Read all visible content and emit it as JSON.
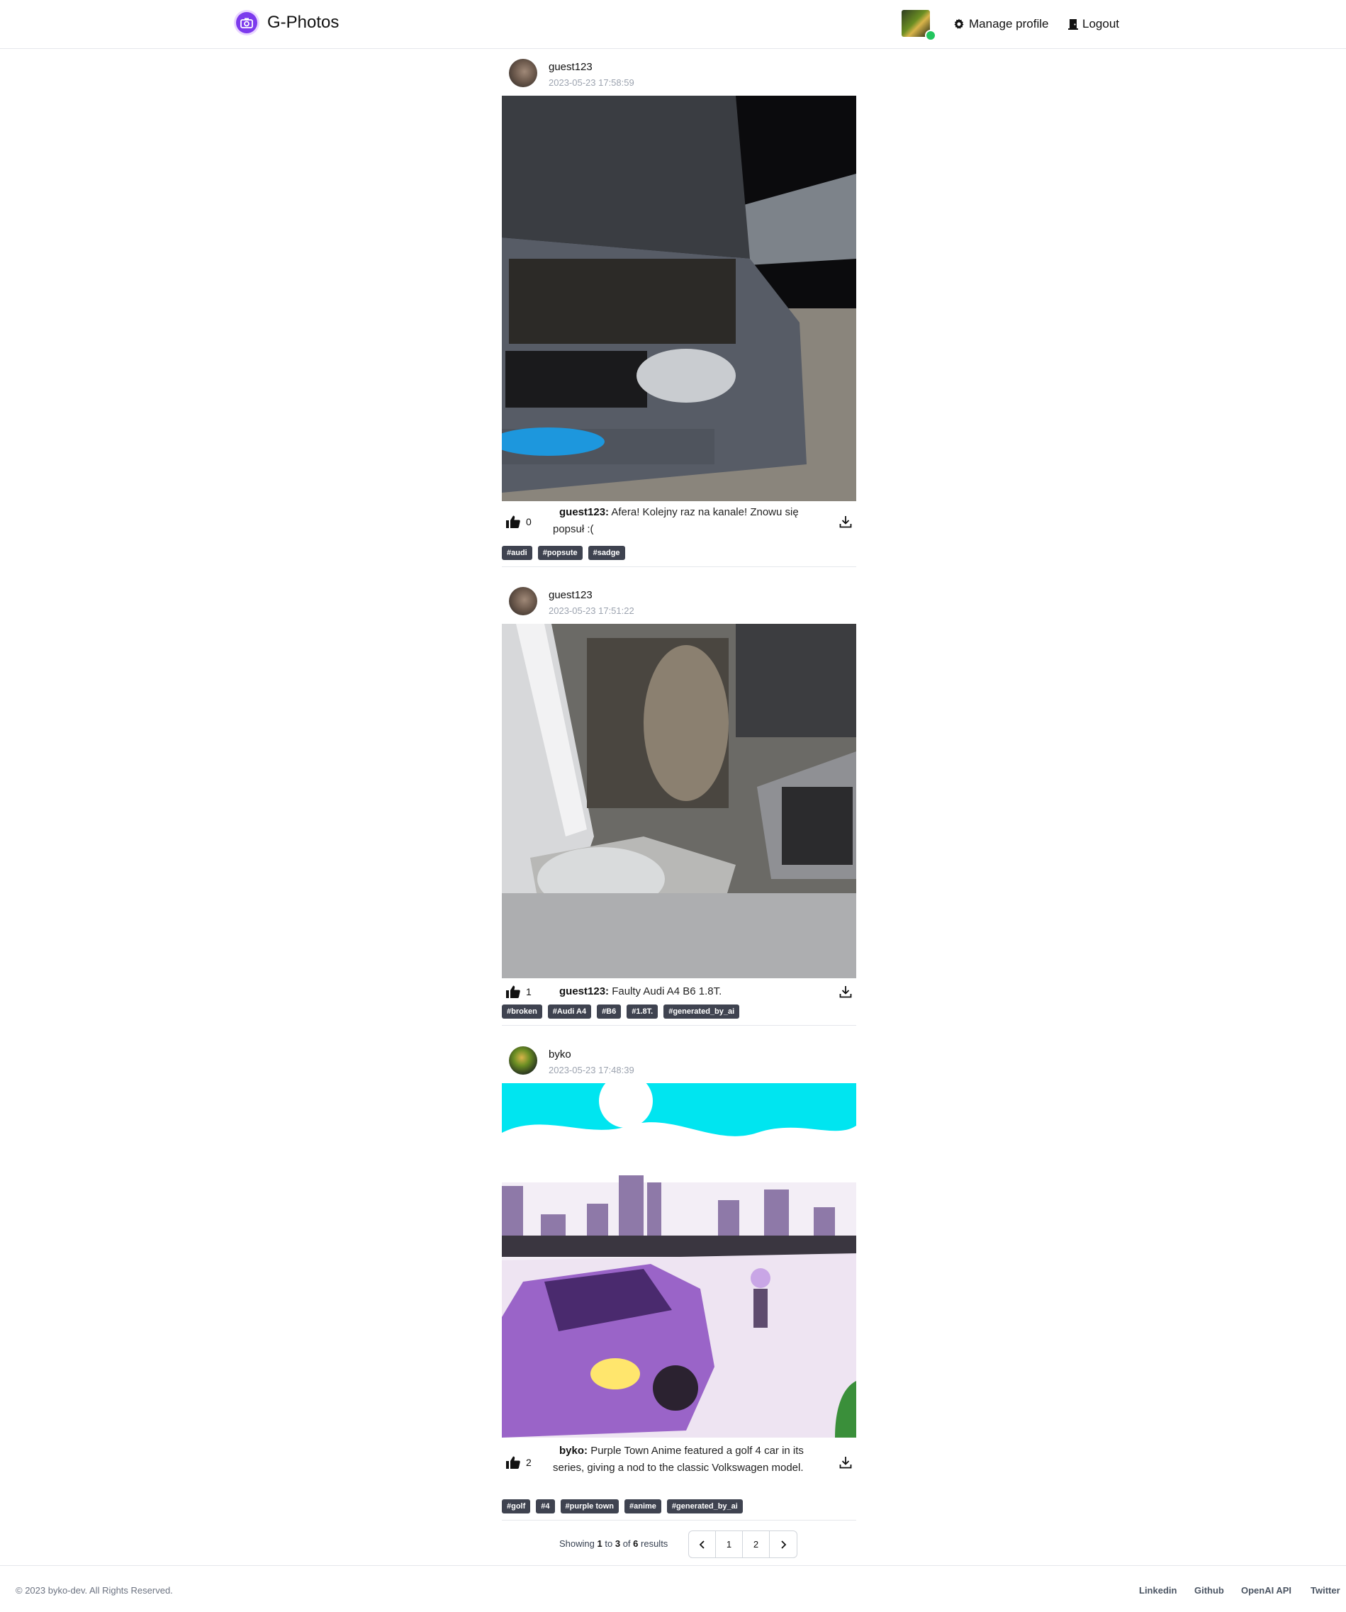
{
  "navbar": {
    "brand": "G-Photos",
    "manage_profile": "Manage profile",
    "logout": "Logout"
  },
  "posts": [
    {
      "author": "guest123",
      "timestamp": "2023-05-23 17:58:59",
      "likes": "0",
      "caption_author": "guest123:",
      "caption": "Afera! Kolejny raz na kanale! Znowu się popsuł :(",
      "tags": [
        "#audi",
        "#popsute",
        "#sadge"
      ]
    },
    {
      "author": "guest123",
      "timestamp": "2023-05-23 17:51:22",
      "likes": "1",
      "caption_author": "guest123:",
      "caption": "Faulty Audi A4 B6 1.8T.",
      "tags": [
        "#broken",
        "#Audi A4",
        "#B6",
        "#1.8T.",
        "#generated_by_ai"
      ]
    },
    {
      "author": "byko",
      "timestamp": "2023-05-23 17:48:39",
      "likes": "2",
      "caption_author": "byko:",
      "caption": "Purple Town Anime featured a golf 4 car in its series, giving a nod to the classic Volkswagen model.",
      "tags": [
        "#golf",
        "#4",
        "#purple town",
        "#anime",
        "#generated_by_ai"
      ]
    }
  ],
  "pagination": {
    "showing": "Showing",
    "from": "1",
    "to_word": "to",
    "to": "3",
    "of_word": "of",
    "total": "6",
    "results_word": "results",
    "pages": [
      "1",
      "2"
    ]
  },
  "footer": {
    "copyright": "© 2023 byko-dev. All Rights Reserved.",
    "links": [
      "Linkedin",
      "Github",
      "OpenAI API",
      "Twitter"
    ]
  }
}
